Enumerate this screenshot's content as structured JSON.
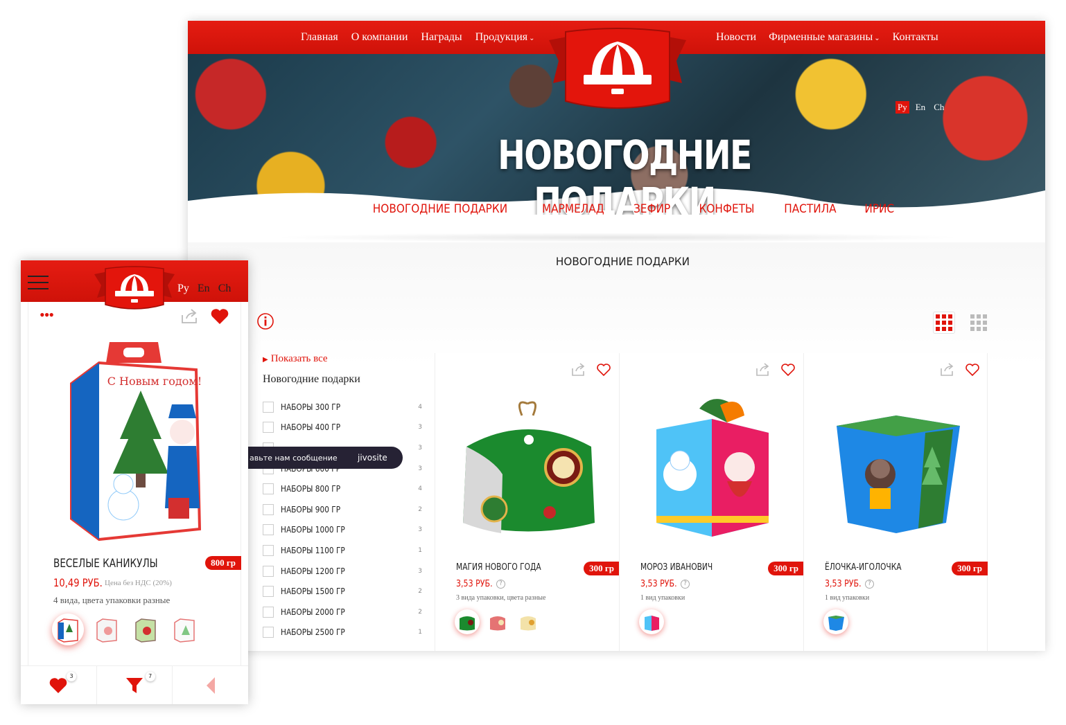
{
  "desktop": {
    "nav_left": [
      {
        "label": "Главная"
      },
      {
        "label": "О компании"
      },
      {
        "label": "Награды"
      },
      {
        "label": "Продукция",
        "has_dropdown": true
      }
    ],
    "nav_right": [
      {
        "label": "Новости"
      },
      {
        "label": "Фирменные магазины",
        "has_dropdown": true
      },
      {
        "label": "Контакты"
      }
    ],
    "languages": [
      "Ру",
      "En",
      "Ch"
    ],
    "active_language": "Ру",
    "hero_title": "НОВОГОДНИЕ ПОДАРКИ",
    "categories": [
      "НОВОГОДНИЕ ПОДАРКИ",
      "МАРМЕЛАД",
      "ЗЕФИР",
      "КОНФЕТЫ",
      "ПАСТИЛА",
      "ИРИС"
    ],
    "page_title": "НОВОГОДНИЕ ПОДАРКИ",
    "sidebar": {
      "show_all": "Показать все",
      "category_title": "Новогодние подарки",
      "filters": [
        {
          "label": "НАБОРЫ 300 ГР",
          "count": "4"
        },
        {
          "label": "НАБОРЫ 400 ГР",
          "count": "3"
        },
        {
          "label": "",
          "count": "3"
        },
        {
          "label": "НАБОРЫ 600 ГР",
          "count": "3"
        },
        {
          "label": "НАБОРЫ 800 ГР",
          "count": "4"
        },
        {
          "label": "НАБОРЫ 900 ГР",
          "count": "2"
        },
        {
          "label": "НАБОРЫ 1000 ГР",
          "count": "3"
        },
        {
          "label": "НАБОРЫ 1100 ГР",
          "count": "1"
        },
        {
          "label": "НАБОРЫ 1200 ГР",
          "count": "3"
        },
        {
          "label": "НАБОРЫ 1500 ГР",
          "count": "2"
        },
        {
          "label": "НАБОРЫ 2000 ГР",
          "count": "2"
        },
        {
          "label": "НАБОРЫ 2500 ГР",
          "count": "1"
        }
      ]
    },
    "chat": {
      "message": "авьте нам сообщение",
      "brand": "jivosite"
    },
    "products": [
      {
        "name": "МАГИЯ НОВОГО ГОДА",
        "weight": "300 гр",
        "price": "3,53 РУБ.",
        "variants": "3 вида упаковки, цвета разные",
        "thumb_count": 3
      },
      {
        "name": "МОРОЗ ИВАНОВИЧ",
        "weight": "300 гр",
        "price": "3,53 РУБ.",
        "variants": "1 вид упаковки",
        "thumb_count": 1
      },
      {
        "name": "ЁЛОЧКА-ИГОЛОЧКА",
        "weight": "300 гр",
        "price": "3,53 РУБ.",
        "variants": "1 вид упаковки",
        "thumb_count": 1
      }
    ]
  },
  "mobile": {
    "languages": [
      "Ру",
      "En",
      "Ch"
    ],
    "active_language": "Ру",
    "product": {
      "name": "ВЕСЕЛЫЕ КАНИКУЛЫ",
      "weight": "800 гр",
      "price": "10,49 РУБ.",
      "vat_note": "Цена без НДС (20%)",
      "variants": "4 вида, цвета упаковки разные",
      "thumb_count": 4,
      "image_text": "С Новым годом!"
    },
    "bottom_bar": {
      "favorites_count": "3",
      "filter_count": "7"
    }
  },
  "colors": {
    "brand_red": "#e0140b",
    "header_red": "#d9160c",
    "text_dark": "#222222"
  }
}
